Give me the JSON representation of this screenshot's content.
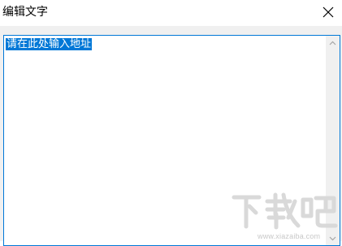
{
  "window": {
    "title": "编辑文字"
  },
  "icons": {
    "close": "close-icon",
    "scroll_up": "chevron-up-icon",
    "scroll_down": "chevron-down-icon"
  },
  "editor": {
    "text": "请在此处输入地址",
    "selected": true
  },
  "colors": {
    "accent": "#0078d7",
    "content_background": "#f0f0f0",
    "watermark": "#d9d9d9"
  },
  "watermark": {
    "logo_text": "下载吧",
    "url": "www.xiazaiba.com"
  }
}
